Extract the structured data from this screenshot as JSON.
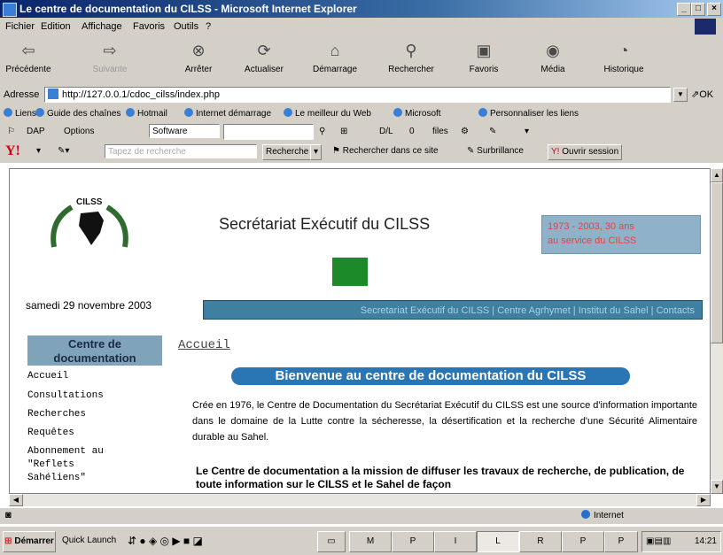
{
  "window": {
    "title": "Le centre de documentation du CILSS - Microsoft Internet Explorer"
  },
  "menu": [
    "Fichier",
    "Edition",
    "Affichage",
    "Favoris",
    "Outils",
    "?"
  ],
  "toolbar": {
    "back": "Précédente",
    "forward": "Suivante",
    "stop": "Arrêter",
    "refresh": "Actualiser",
    "home": "Démarrage",
    "search": "Rechercher",
    "favorites": "Favoris",
    "media": "Média",
    "history": "Historique"
  },
  "address": {
    "label": "Adresse",
    "url": "http://127.0.0.1/cdoc_cilss/index.php",
    "go": "OK"
  },
  "links": {
    "label": "Liens",
    "items": [
      "Guide des chaînes",
      "Hotmail",
      "Internet démarrage",
      "Le meilleur du Web",
      "Microsoft",
      "Personnaliser les liens"
    ]
  },
  "dap": {
    "dap": "DAP",
    "options": "Options",
    "software": "Software",
    "dl": "D/L",
    "dl_count": "0",
    "files": "files"
  },
  "yahoo": {
    "placeholder": "Tapez de recherche",
    "search_btn": "Recherche",
    "site_search": "Rechercher dans ce site",
    "highlight": "Surbrillance",
    "open_session": "Ouvrir session"
  },
  "page": {
    "logo_text": "CILSS",
    "date": "samedi 29 novembre 2003",
    "heading": "Secrétariat Exécutif du CILSS",
    "badge_line1": "1973 - 2003, 30 ans",
    "badge_line2": "au service du CILSS",
    "nav": "Secretariat Exécutif du CILSS | Centre Agrhymet | Institut du Sahel | Contacts",
    "sidebar_title": "Centre de documentation",
    "sidebar_links": [
      "Accueil",
      "Consultations",
      "Recherches",
      "Requêtes",
      "Abonnement au",
      "\"Reflets",
      "Sahéliens\""
    ],
    "section_title": "Accueil",
    "welcome": "Bienvenue au centre de documentation du CILSS",
    "intro": "Crée en 1976, le Centre de Documentation du Secrétariat Exécutif du CILSS est une source d'information importante dans le domaine de la Lutte contre la sécheresse, la désertification et la recherche d'une Sécurité Alimentaire durable au Sahel.",
    "mission": "Le Centre de documentation a la mission de diffuser les travaux de recherche, de publication, de toute information sur le CILSS et le Sahel de façon"
  },
  "status": {
    "zone": "Internet"
  },
  "taskbar": {
    "start": "Démarrer",
    "quicklaunch": "Quick Launch",
    "tasks": [
      "M",
      "P",
      "I",
      "L",
      "R",
      "P",
      "P"
    ],
    "clock": "14:21"
  }
}
